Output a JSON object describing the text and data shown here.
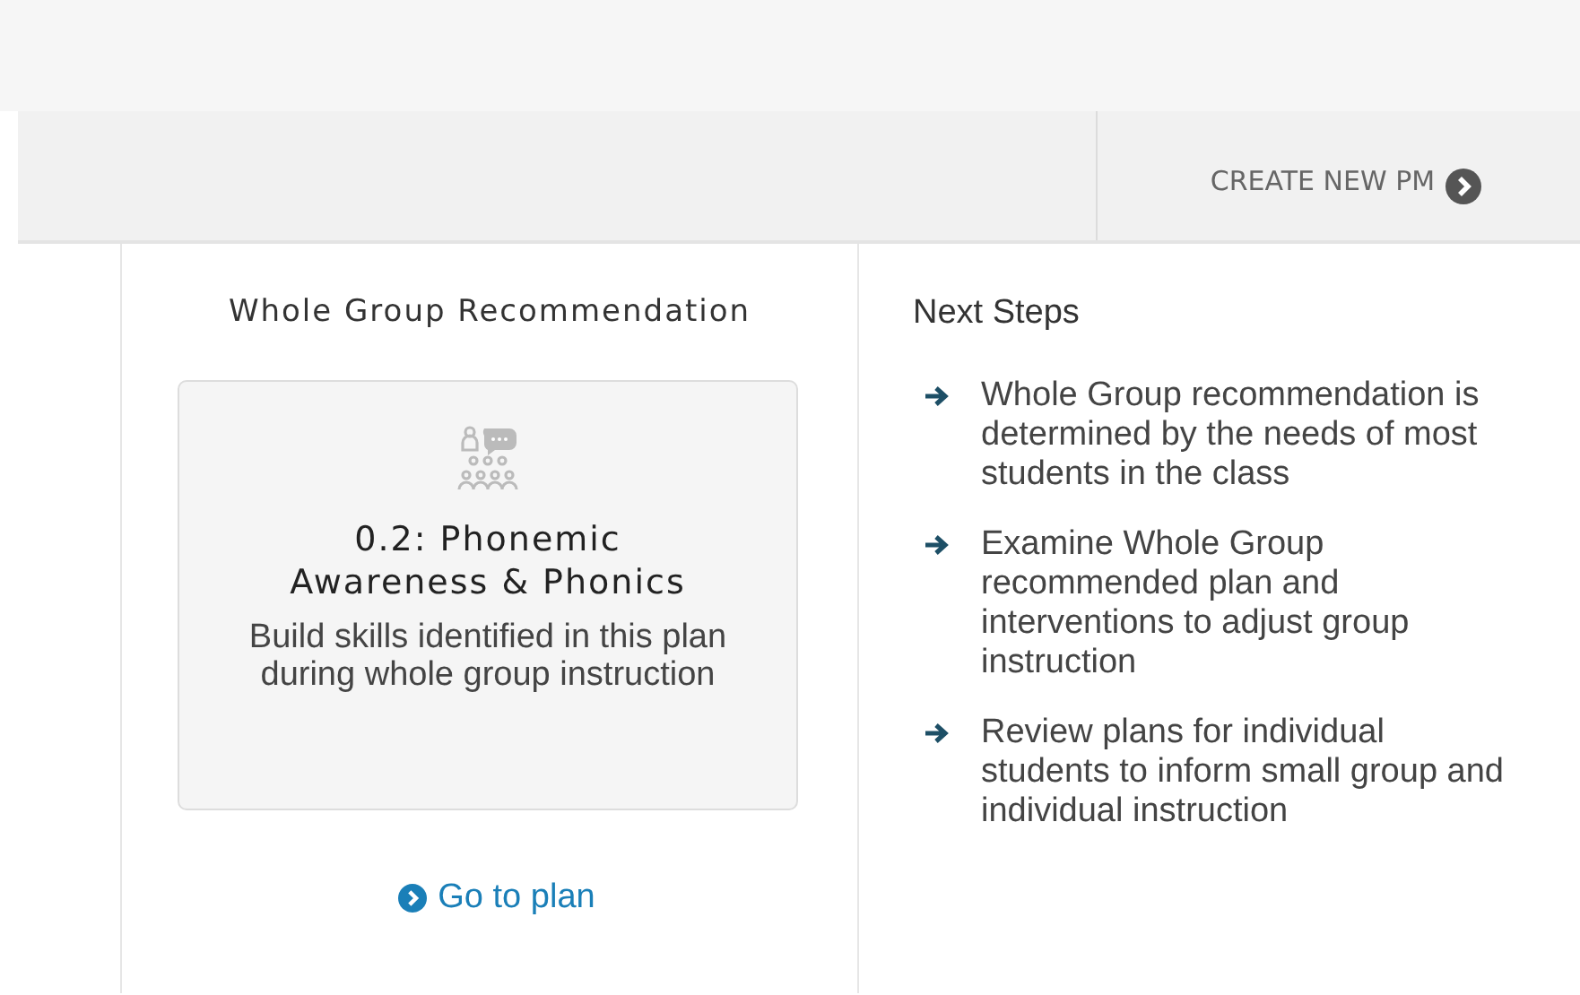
{
  "header": {
    "create_button": "CREATE NEW PM"
  },
  "recommendation": {
    "heading": "Whole Group Recommendation",
    "card": {
      "title": "0.2: Phonemic Awareness & Phonics",
      "description": "Build skills identified in this plan during whole group instruction"
    },
    "link": "Go to plan"
  },
  "next_steps": {
    "heading": "Next Steps",
    "items": [
      {
        "text": "Whole Group recommendation is determined by the needs of most students in the class"
      },
      {
        "text": "Examine Whole Group recommended plan and interventions to adjust group instruction"
      },
      {
        "text": "Review plans for individual students to inform small group and individual instruction"
      }
    ]
  }
}
